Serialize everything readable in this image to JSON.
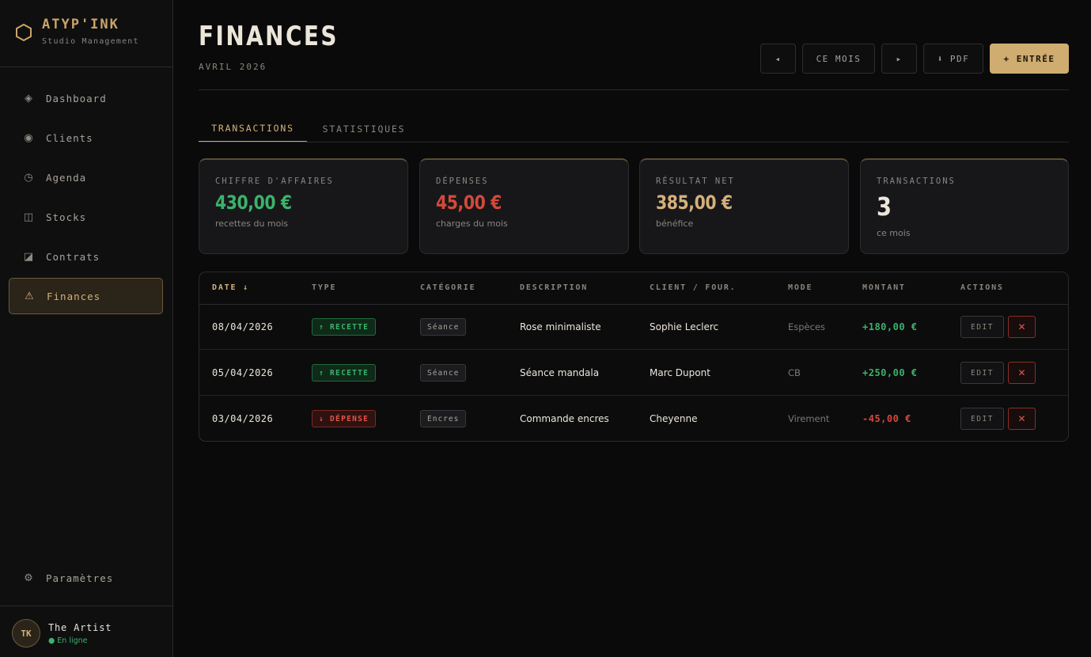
{
  "brand": {
    "name": "ATYP'INK",
    "subtitle": "Studio Management",
    "icon": "hexagon-icon",
    "accent": "#c9a46a"
  },
  "nav": [
    {
      "label": "Dashboard",
      "icon": "diamond-icon",
      "glyph": "◈"
    },
    {
      "label": "Clients",
      "icon": "circle-icon",
      "glyph": "◉"
    },
    {
      "label": "Agenda",
      "icon": "clock-icon",
      "glyph": "◷"
    },
    {
      "label": "Stocks",
      "icon": "columns-icon",
      "glyph": "◫"
    },
    {
      "label": "Contrats",
      "icon": "half-square-icon",
      "glyph": "◪"
    },
    {
      "label": "Finances",
      "icon": "warning-triangle-icon",
      "glyph": "⚠",
      "active": true
    }
  ],
  "settings": {
    "label": "Paramètres",
    "icon": "gear-icon",
    "glyph": "⚙"
  },
  "user": {
    "initials": "TK",
    "name": "The Artist",
    "status": "● En ligne"
  },
  "header": {
    "title": "FINANCES",
    "subtitle": "AVRIL 2026",
    "prev_label": "◂",
    "current_label": "CE MOIS",
    "next_label": "▸",
    "pdf_label": "⬇ PDF",
    "add_label": "+ ENTRÉE"
  },
  "tabs": [
    {
      "label": "TRANSACTIONS",
      "active": true
    },
    {
      "label": "STATISTIQUES",
      "active": false
    }
  ],
  "cards": [
    {
      "label": "CHIFFRE D'AFFAIRES",
      "value": "430,00 €",
      "note": "recettes du mois",
      "color": "#3bb36a"
    },
    {
      "label": "DÉPENSES",
      "value": "45,00 €",
      "note": "charges du mois",
      "color": "#d4493a"
    },
    {
      "label": "RÉSULTAT NET",
      "value": "385,00 €",
      "note": "bénéfice",
      "color": "#d4b07a"
    },
    {
      "label": "TRANSACTIONS",
      "value": "3",
      "note": "ce mois",
      "color": "#ece6da"
    }
  ],
  "table": {
    "columns": [
      "DATE ↓",
      "TYPE",
      "CATÉGORIE",
      "DESCRIPTION",
      "CLIENT / FOUR.",
      "MODE",
      "MONTANT",
      "ACTIONS"
    ],
    "edit_label": "EDIT",
    "delete_label": "✕",
    "rows": [
      {
        "date": "08/04/2026",
        "type": "↑ RECETTE",
        "kind": "in",
        "category": "Séance",
        "description": "Rose minimaliste",
        "client": "Sophie Leclerc",
        "mode": "Espèces",
        "amount": "+180,00 €"
      },
      {
        "date": "05/04/2026",
        "type": "↑ RECETTE",
        "kind": "in",
        "category": "Séance",
        "description": "Séance mandala",
        "client": "Marc Dupont",
        "mode": "CB",
        "amount": "+250,00 €"
      },
      {
        "date": "03/04/2026",
        "type": "↓ DÉPENSE",
        "kind": "out",
        "category": "Encres",
        "description": "Commande encres",
        "client": "Cheyenne",
        "mode": "Virement",
        "amount": "-45,00 €"
      }
    ]
  }
}
